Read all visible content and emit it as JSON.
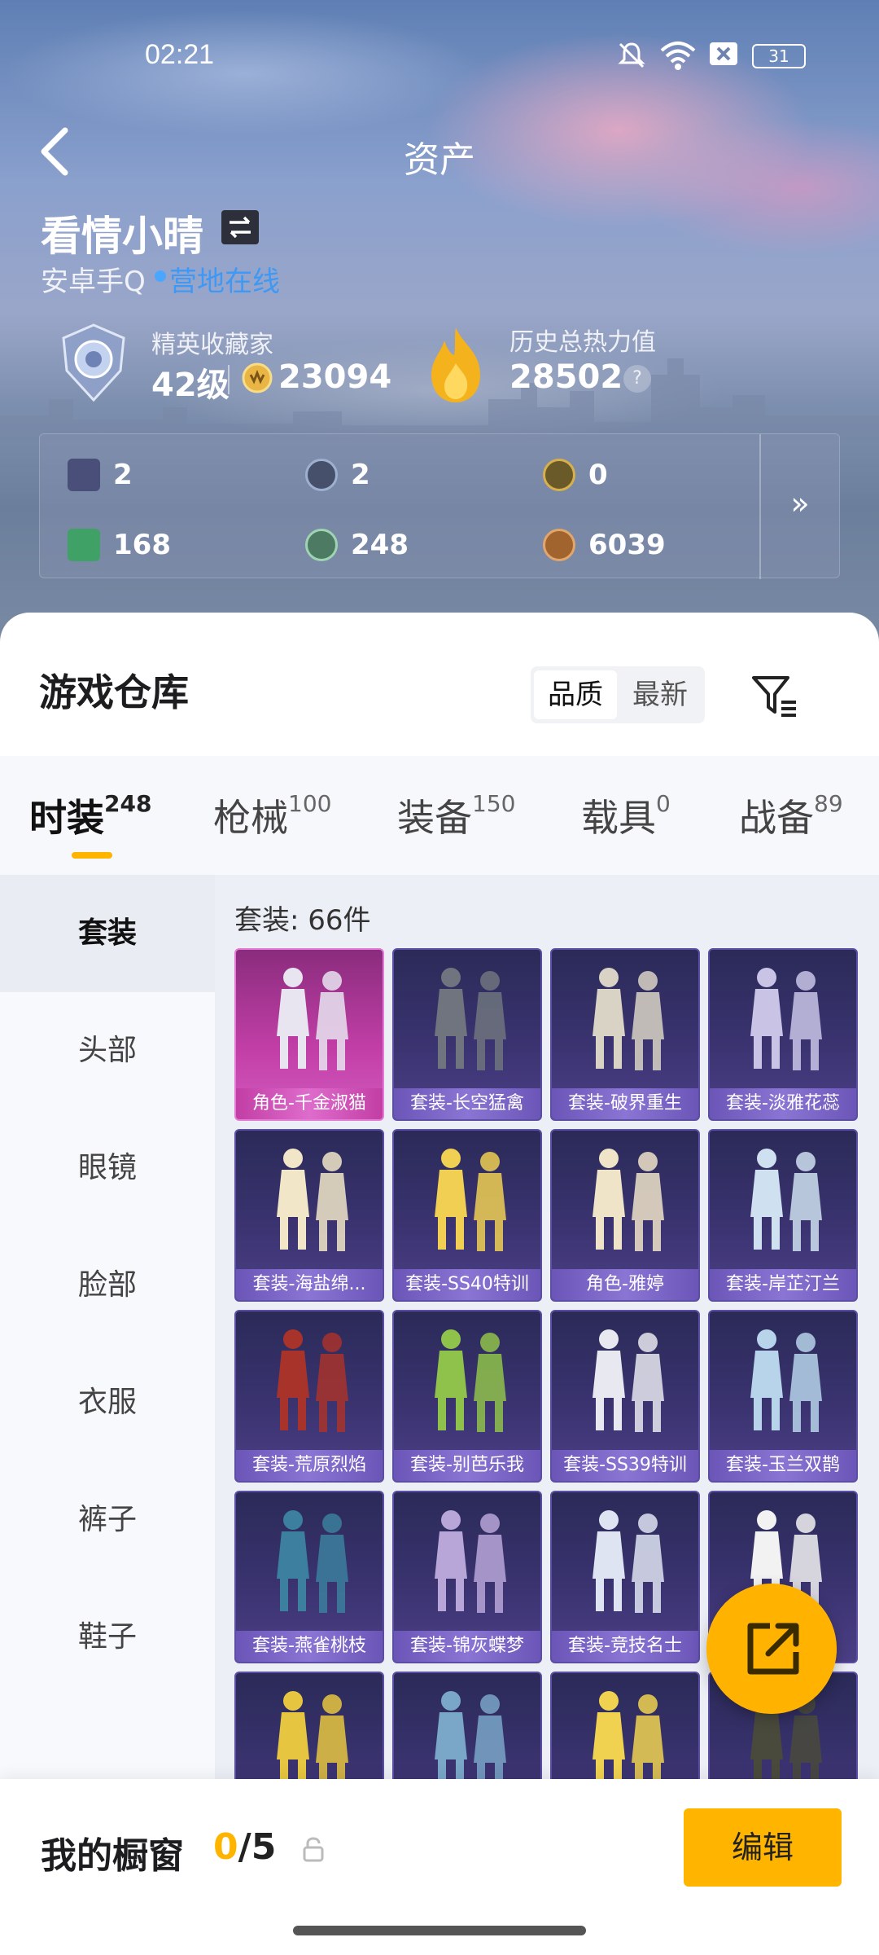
{
  "status_bar": {
    "time": "02:21",
    "battery": "31"
  },
  "header": {
    "title": "资产"
  },
  "profile": {
    "name": "看情小晴",
    "platform": "安卓手Q",
    "online_status": "营地在线",
    "rank_title": "精英收藏家",
    "level": "42级",
    "coins": "23094",
    "heat_title": "历史总热力值",
    "heat_value": "28502",
    "help_icon": "?"
  },
  "resources": [
    {
      "icon": "card-icon",
      "value": "2"
    },
    {
      "icon": "s-token-icon",
      "value": "2"
    },
    {
      "icon": "a-token-icon",
      "value": "0"
    },
    {
      "icon": "ticket-icon",
      "value": "168"
    },
    {
      "icon": "gem-icon",
      "value": "248"
    },
    {
      "icon": "bronze-coin-icon",
      "value": "6039"
    }
  ],
  "resources_more": "»",
  "warehouse": {
    "title": "游戏仓库",
    "sort_options": [
      "品质",
      "最新"
    ],
    "active_sort": "品质"
  },
  "tabs": [
    {
      "label": "时装",
      "count": "248"
    },
    {
      "label": "枪械",
      "count": "100"
    },
    {
      "label": "装备",
      "count": "150"
    },
    {
      "label": "载具",
      "count": "0"
    },
    {
      "label": "战备",
      "count": "89"
    }
  ],
  "sidebar": [
    "套装",
    "头部",
    "眼镜",
    "脸部",
    "衣服",
    "裤子",
    "鞋子"
  ],
  "content_heading": "套装: 66件",
  "items": [
    {
      "label": "角色-千金淑猫",
      "rarity": "pink"
    },
    {
      "label": "套装-长空猛禽",
      "rarity": "purple"
    },
    {
      "label": "套装-破界重生",
      "rarity": "purple"
    },
    {
      "label": "套装-淡雅花蕊",
      "rarity": "purple"
    },
    {
      "label": "套装-海盐绵...",
      "rarity": "purple"
    },
    {
      "label": "套装-SS40特训",
      "rarity": "purple"
    },
    {
      "label": "角色-雅婷",
      "rarity": "purple"
    },
    {
      "label": "套装-岸芷汀兰",
      "rarity": "purple"
    },
    {
      "label": "套装-荒原烈焰",
      "rarity": "purple"
    },
    {
      "label": "套装-别芭乐我",
      "rarity": "purple"
    },
    {
      "label": "套装-SS39特训",
      "rarity": "purple"
    },
    {
      "label": "套装-玉兰双鹊",
      "rarity": "purple"
    },
    {
      "label": "套装-燕雀桃枝",
      "rarity": "purple"
    },
    {
      "label": "套装-锦灰蝶梦",
      "rarity": "purple"
    },
    {
      "label": "套装-竞技名士",
      "rarity": "purple"
    },
    {
      "label": "",
      "rarity": "purple"
    },
    {
      "label": "",
      "rarity": "purple"
    },
    {
      "label": "",
      "rarity": "purple"
    },
    {
      "label": "",
      "rarity": "purple"
    },
    {
      "label": "",
      "rarity": "purple"
    }
  ],
  "showcase": {
    "label": "我的橱窗",
    "current": "0",
    "total": "/5",
    "edit_label": "编辑"
  }
}
